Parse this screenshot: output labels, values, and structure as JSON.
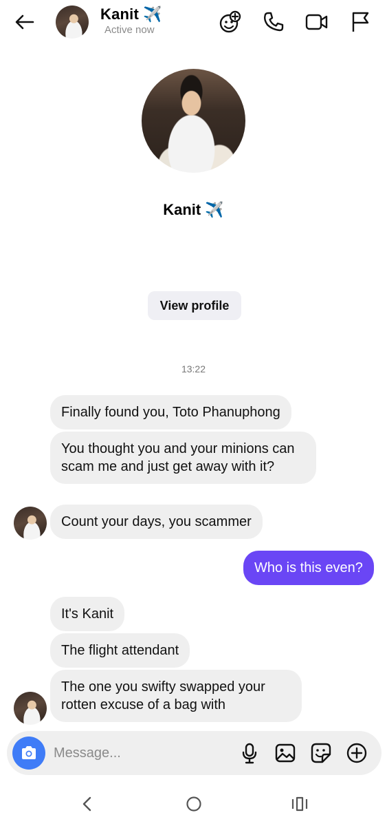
{
  "header": {
    "contact_name": "Kanit",
    "name_emoji": "✈️",
    "status": "Active now",
    "icons": [
      "back-arrow-icon",
      "add-emoji-icon",
      "phone-icon",
      "video-camera-icon",
      "flag-icon"
    ]
  },
  "profile": {
    "name": "Kanit",
    "name_emoji": "✈️",
    "view_profile_label": "View profile"
  },
  "conversation": {
    "timestamp": "13:22",
    "messages": [
      {
        "from": "them",
        "text": "Finally found you, Toto Phanuphong"
      },
      {
        "from": "them",
        "text": "You thought you and your minions can scam me and just get away with it?"
      },
      {
        "from": "them",
        "text": "Count your days, you scammer"
      },
      {
        "from": "me",
        "text": "Who is this even?"
      },
      {
        "from": "them",
        "text": "It's Kanit"
      },
      {
        "from": "them",
        "text": "The flight attendant"
      },
      {
        "from": "them",
        "text": "The one you swifty swapped your rotten excuse of a bag with"
      }
    ]
  },
  "composer": {
    "placeholder": "Message...",
    "icons": [
      "camera-icon",
      "microphone-icon",
      "image-icon",
      "sticker-icon",
      "plus-circle-icon"
    ]
  },
  "navigation": {
    "icons": [
      "nav-back-icon",
      "nav-home-icon",
      "nav-recents-icon"
    ]
  },
  "colors": {
    "sent_bubble": "#6a46f5",
    "received_bubble": "#efefef",
    "camera_button": "#3f7cf7",
    "status_text": "#8a8a8a"
  }
}
